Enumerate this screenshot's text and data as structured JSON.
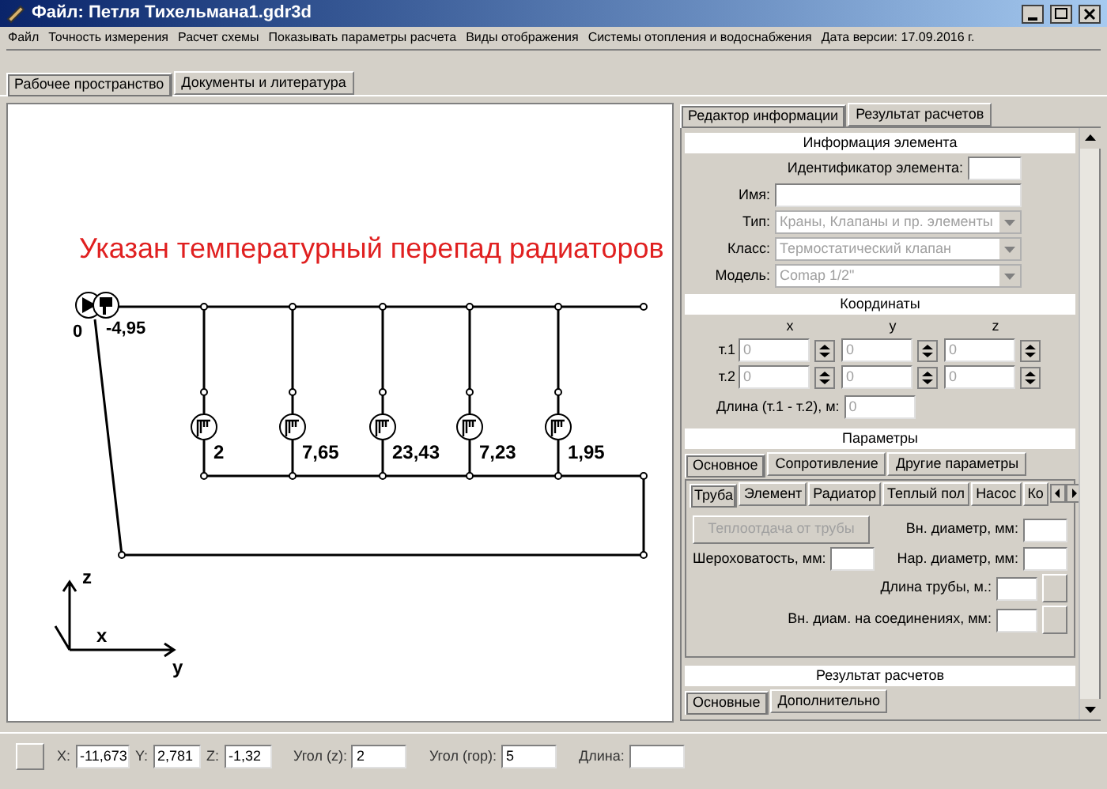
{
  "window": {
    "title": "Файл: Петля Тихельмана1.gdr3d"
  },
  "menu": [
    "Файл",
    "Точность измерения",
    "Расчет схемы",
    "Показывать параметры расчета",
    "Виды отображения",
    "Системы отопления и водоснабжения",
    "Дата версии: 17.09.2016 г."
  ],
  "tabs": [
    {
      "label": "Рабочее пространство",
      "selected": true
    },
    {
      "label": "Документы и литература",
      "selected": false
    }
  ],
  "caption": "Указан температурный перепад радиаторов",
  "schematic": {
    "start_label": "0",
    "source_label": "-4,95",
    "radiators": [
      {
        "value": "2"
      },
      {
        "value": "7,65"
      },
      {
        "value": "23,43"
      },
      {
        "value": "7,23"
      },
      {
        "value": "1,95"
      }
    ],
    "axes": {
      "z": "z",
      "x": "x",
      "y": "y"
    }
  },
  "panel": {
    "tabs": [
      {
        "label": "Редактор информации",
        "selected": true
      },
      {
        "label": "Результат расчетов",
        "selected": false
      }
    ],
    "info": {
      "header": "Информация элемента",
      "id_label": "Идентификатор элемента:",
      "name_label": "Имя:",
      "selects": [
        {
          "label": "Тип:",
          "value": "Краны, Клапаны и пр. элементы"
        },
        {
          "label": "Класс:",
          "value": "Термостатический клапан"
        },
        {
          "label": "Модель:",
          "value": "Comap 1/2\""
        }
      ]
    },
    "coords": {
      "header": "Координаты",
      "columns": [
        "x",
        "y",
        "z"
      ],
      "rows": [
        {
          "label": "т.1",
          "values": [
            "0",
            "0",
            "0"
          ]
        },
        {
          "label": "т.2",
          "values": [
            "0",
            "0",
            "0"
          ]
        }
      ],
      "length_label": "Длина (т.1 - т.2), м:",
      "length_value": "0"
    },
    "params": {
      "header": "Параметры",
      "tabs": [
        {
          "label": "Основное",
          "selected": true
        },
        {
          "label": "Сопротивление",
          "selected": false
        },
        {
          "label": "Другие параметры",
          "selected": false
        }
      ],
      "subtabs": [
        {
          "label": "Труба",
          "selected": true
        },
        {
          "label": "Элемент",
          "selected": false
        },
        {
          "label": "Радиатор",
          "selected": false
        },
        {
          "label": "Теплый пол",
          "selected": false
        },
        {
          "label": "Насос",
          "selected": false
        },
        {
          "label": "Ко",
          "selected": false
        }
      ],
      "button": {
        "label": "Теплоотдача от трубы",
        "disabled": true
      },
      "inner_diameter": "Вн. диаметр, мм:",
      "roughness": "Шероховатость, мм:",
      "outer_diameter": "Нар. диаметр, мм:",
      "pipe_length": "Длина трубы, м.:",
      "joint_diameter": "Вн. диам. на соединениях, мм:"
    },
    "results": {
      "header": "Результат расчетов",
      "tabs": [
        {
          "label": "Основные",
          "selected": true
        },
        {
          "label": "Дополнительно",
          "selected": false
        }
      ]
    }
  },
  "status_bar": [
    {
      "label": "X:",
      "value": "-11,673"
    },
    {
      "label": "Y:",
      "value": "2,781"
    },
    {
      "label": "Z:",
      "value": "-1,32"
    },
    {
      "label": "Угол (z):",
      "value": "2"
    },
    {
      "label": "Угол (гор):",
      "value": "5"
    },
    {
      "label": "Длина:"
    }
  ]
}
